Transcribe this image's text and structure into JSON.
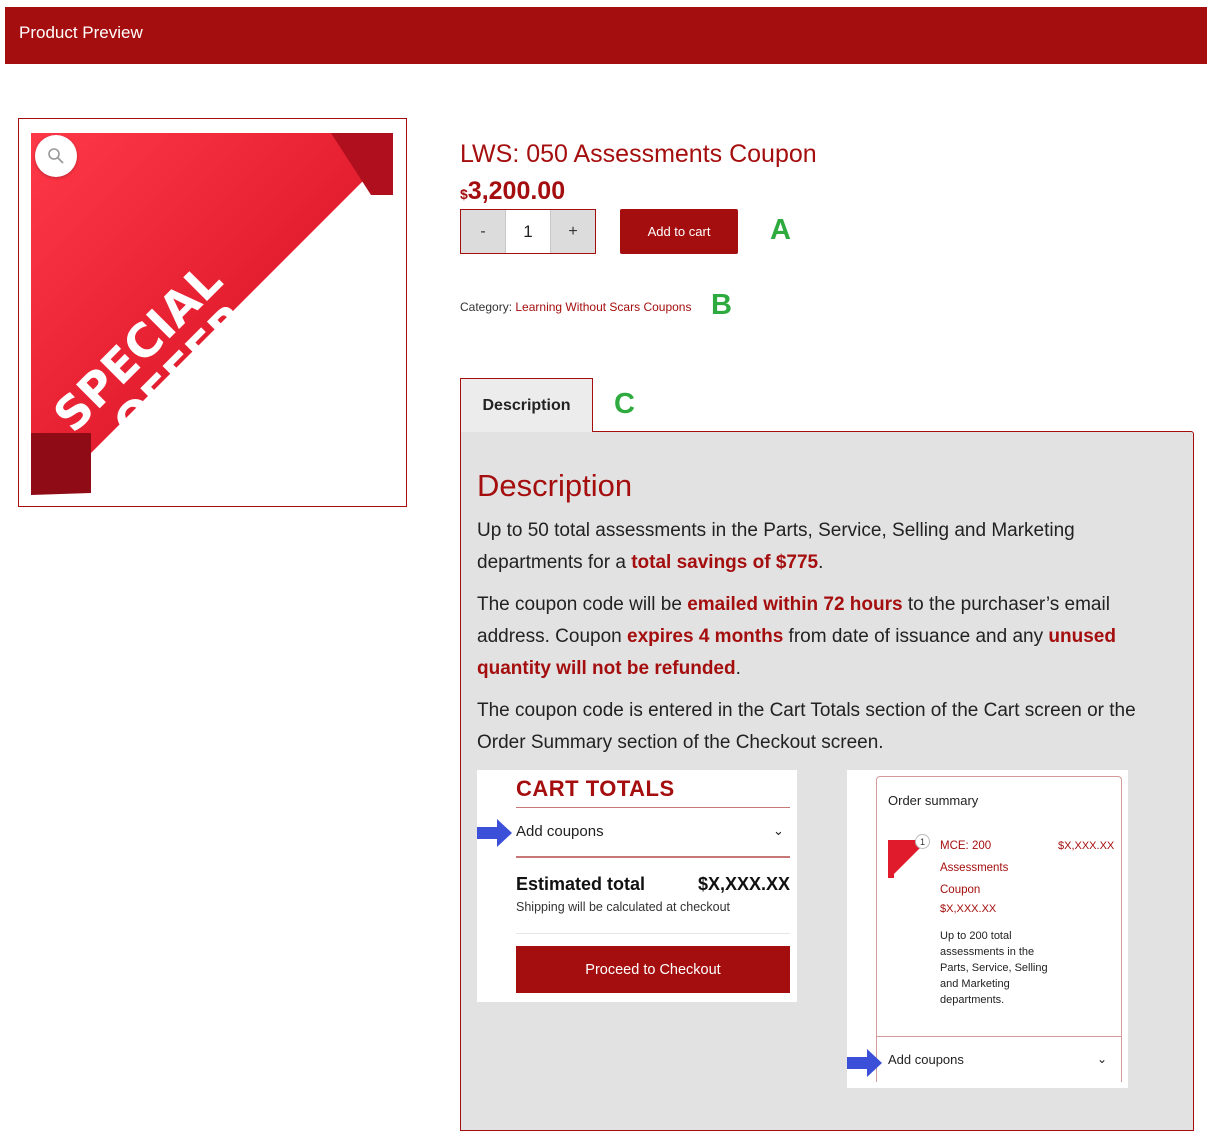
{
  "header": {
    "title": "Product Preview"
  },
  "product": {
    "image_text": [
      "SPECIAL",
      "OFFER"
    ],
    "title": "LWS: 050 Assessments Coupon",
    "currency": "$",
    "price": "3,200.00",
    "quantity": "1",
    "minus_label": "-",
    "plus_label": "+",
    "add_to_cart_label": "Add to cart",
    "category_label": "Category:",
    "category_link": "Learning Without Scars Coupons"
  },
  "annotations": {
    "a": "A",
    "b": "B",
    "c": "C"
  },
  "tabs": {
    "description_label": "Description"
  },
  "description": {
    "heading": "Description",
    "p1_a": "Up to 50 total assessments in the Parts, Service, Selling and Marketing departments for a ",
    "p1_b": "total savings of $775",
    "p1_c": ".",
    "p2_a": "The coupon code will be ",
    "p2_b": "emailed within 72 hours",
    "p2_c": " to the purchaser’s email address. Coupon ",
    "p2_d": "expires 4 months",
    "p2_e": " from date of issuance and any ",
    "p2_f": "unused quantity will not be refunded",
    "p2_g": ".",
    "p3": "The coupon code is entered in the Cart Totals section of the Cart screen or the Order Summary section of the Checkout screen."
  },
  "cart_totals": {
    "title": "CART TOTALS",
    "add_coupons": "Add coupons",
    "estimated_label": "Estimated total",
    "estimated_value": "$X,XXX.XX",
    "shipping_note": "Shipping will be calculated at checkout",
    "checkout_button": "Proceed to Checkout"
  },
  "order_summary": {
    "title": "Order summary",
    "badge": "1",
    "item_name": "MCE: 200 Assessments Coupon",
    "item_price": "$X,XXX.XX",
    "row_price": "$X,XXX.XX",
    "item_desc": "Up to 200 total assessments in the Parts, Service, Selling and Marketing departments.",
    "add_coupons": "Add coupons"
  },
  "colors": {
    "brand": "#a50e0e",
    "annotation": "#2eaa3f",
    "arrow": "#3b4fd8",
    "panel": "#e2e2e2"
  }
}
